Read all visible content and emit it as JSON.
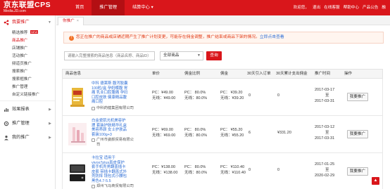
{
  "header": {
    "logo_title": "京东联盟CPS",
    "logo_subtitle": "Media.JD.com",
    "nav": [
      {
        "label": "首页",
        "active": false
      },
      {
        "label": "推广管理",
        "active": true
      },
      {
        "label": "结算中心 ▾",
        "active": false
      }
    ],
    "right_links": [
      "欢迎您，",
      "退出",
      "在线客服",
      "帮助中心",
      "产品公告",
      "融"
    ]
  },
  "sidebar": {
    "groups": [
      {
        "label": "我要推广",
        "icon": "share-icon",
        "open": true,
        "items": [
          {
            "label": "精选推荐",
            "active": false,
            "badge": "NEW"
          },
          {
            "label": "商品推广",
            "active": true
          },
          {
            "label": "店铺推广",
            "active": false
          },
          {
            "label": "活动推广",
            "active": false
          },
          {
            "label": "频道页推广",
            "active": false
          },
          {
            "label": "搜索推广",
            "active": false
          },
          {
            "label": "搜索框推广",
            "active": false
          },
          {
            "label": "推广管理",
            "active": false
          },
          {
            "label": "自定义链接推广",
            "active": false
          }
        ]
      },
      {
        "label": "效果报表",
        "icon": "chart-icon",
        "open": false,
        "items": []
      },
      {
        "label": "推广管理",
        "icon": "gear-icon",
        "open": false,
        "items": []
      },
      {
        "label": "我的推广",
        "icon": "user-icon",
        "open": false,
        "items": []
      }
    ]
  },
  "breadcrumb": {
    "label": "你推广",
    "close": "×"
  },
  "notice": {
    "text": "您正在推广的商品或店铺近期产生了推广计划变更，可能存在佣金调整，推广结束或商品下架的情况。",
    "link": "立即点击查看"
  },
  "search": {
    "placeholder": "请输入完整搜索的商品信息（商品名称、商品ID）",
    "select_value": "全部商品",
    "button": "查询"
  },
  "colors": {
    "brand": "#d9161b",
    "link": "#2f6fd6",
    "notice_bg": "#fff5ef"
  },
  "table": {
    "columns": [
      "商品信息",
      "单价",
      "佣金比例",
      "佣金",
      "30天引入订单",
      "30天累计支出佣金",
      "推广时间",
      "操作"
    ],
    "rows": [
      {
        "name": "中科 德莱斯 腹泻胶囊100粒/盒 孕妈蝶腹 胃痛 乳业口腔腹痛 孕妇口腔皮肤 健康精品腹痛口腔",
        "shop": "中科药健集团有限公司",
        "price_pc": "PC：¥49.00",
        "price_wx": "无线：¥49.00",
        "rate_pc": "PC：   80.0%",
        "rate_wx": "无线：80.0%",
        "comm_pc": "PC：   ¥39.20",
        "comm_wx": "无线：¥39.20",
        "orders": "0",
        "paid": "0",
        "date_start": "2017-03-17",
        "date_sep": "至",
        "date_end": "2017-03-31",
        "action": "我要推广"
      },
      {
        "name": "白金瓷肌光机美容护理 套装护肤精华礼盒 美容养颜 女士护肤品套装100g+3",
        "shop": "广州市姿颜贸易有限公司",
        "price_pc": "PC：¥69.00",
        "price_wx": "无线：¥69.00",
        "rate_pc": "PC：   80.0%",
        "rate_wx": "无线：80.0%",
        "comm_pc": "PC：   ¥55.20",
        "comm_wx": "无线：¥55.20",
        "orders": "6",
        "paid": "¥331.20",
        "date_start": "2017-03-12",
        "date_sep": "至",
        "date_end": "2017-03-31",
        "action": "我要推广"
      },
      {
        "name": "卡拉宝 适用于vivox7plus真皮保护套手机壳男翻盖插卡皮套 带插卡翻盖式外壳防摔 钱包式小腰包黑色4.7-5.5",
        "shop": "郑州飞马商贸有限公司",
        "price_pc": "PC：¥138.00",
        "price_wx": "无线：¥138.00",
        "rate_pc": "PC：   80.0%",
        "rate_wx": "无线：80.0%",
        "comm_pc": "PC：   ¥110.40",
        "comm_wx": "无线：¥110.40",
        "orders": "0",
        "paid": "0",
        "date_start": "2017-01-25",
        "date_sep": "至",
        "date_end": "2020-02-29",
        "action": "我要推广"
      }
    ]
  },
  "fab": {
    "icon": "chevron-up-icon",
    "glyph": "▲"
  }
}
